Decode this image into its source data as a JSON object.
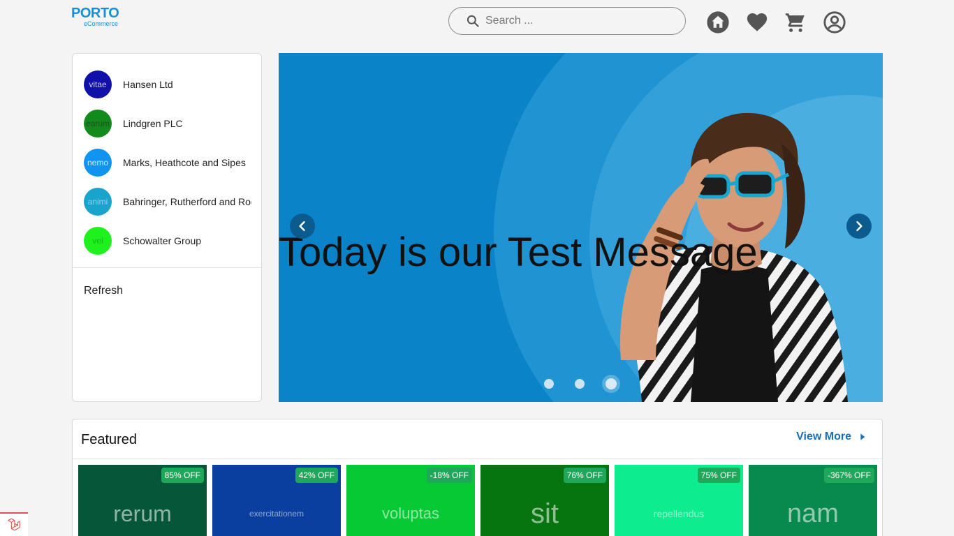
{
  "header": {
    "logo_main": "PORTO",
    "logo_sub": "eCommerce",
    "search_placeholder": "Search ...",
    "icons": [
      "home-icon",
      "heart-icon",
      "cart-icon",
      "account-icon"
    ]
  },
  "sidebar": {
    "brands": [
      {
        "logo_text": "vitae",
        "name": "Hansen Ltd",
        "color": "#1111aa",
        "text_color": "#c8c8f0"
      },
      {
        "logo_text": "earum",
        "name": "Lindgren PLC",
        "color": "#128a1c",
        "text_color": "#2a4a2a"
      },
      {
        "logo_text": "nemo",
        "name": "Marks, Heathcote and Sipes",
        "color": "#1193f0",
        "text_color": "#cfe7fb"
      },
      {
        "logo_text": "animi",
        "name": "Bahringer, Rutherford and Rogahn",
        "color": "#1aa3cc",
        "text_color": "#8fd4ea"
      },
      {
        "logo_text": "vel",
        "name": "Schowalter Group",
        "color": "#1ff11f",
        "text_color": "#19b819"
      }
    ],
    "refresh_label": "Refresh"
  },
  "banner": {
    "title": "Today is our Test Message",
    "slide_count": 3,
    "active_slide": 3,
    "bg_color": "#0a83c8"
  },
  "featured": {
    "title": "Featured",
    "view_more_label": "View More",
    "products": [
      {
        "image_text": "rerum",
        "badge": "85% OFF",
        "color": "#06573a",
        "font_size": 32
      },
      {
        "image_text": "exercitationem",
        "badge": "42% OFF",
        "color": "#0a3fa0",
        "font_size": 12
      },
      {
        "image_text": "voluptas",
        "badge": "-18% OFF",
        "color": "#07c934",
        "font_size": 22
      },
      {
        "image_text": "sit",
        "badge": "76% OFF",
        "color": "#06740f",
        "font_size": 40
      },
      {
        "image_text": "repellendus",
        "badge": "75% OFF",
        "color": "#0ded8f",
        "font_size": 14
      },
      {
        "image_text": "nam",
        "badge": "-367% OFF",
        "color": "#08894e",
        "font_size": 38
      }
    ]
  }
}
